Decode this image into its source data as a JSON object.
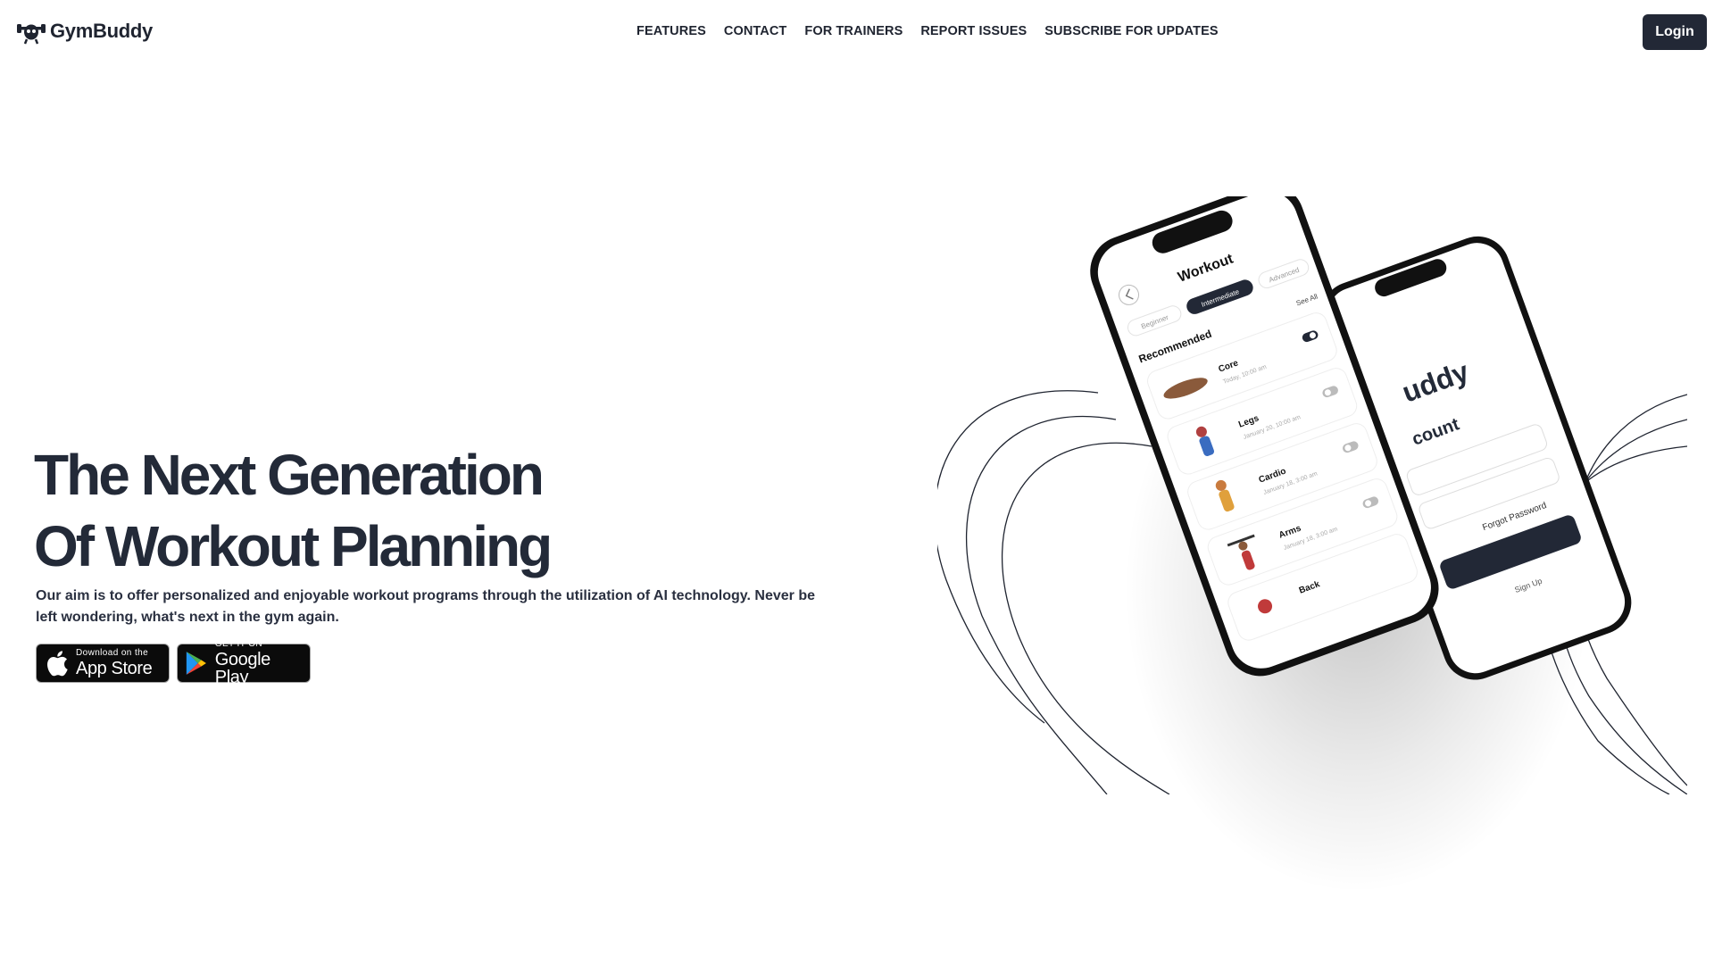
{
  "brand": {
    "name": "GymBuddy",
    "logo_icon": "dumbbell-mascot-icon"
  },
  "nav": {
    "items": [
      {
        "label": "FEATURES"
      },
      {
        "label": "CONTACT"
      },
      {
        "label": "FOR TRAINERS"
      },
      {
        "label": "REPORT ISSUES"
      },
      {
        "label": "SUBSCRIBE FOR UPDATES"
      }
    ],
    "login_label": "Login"
  },
  "hero": {
    "title_line1": "The Next Generation",
    "title_line2": "Of Workout Planning",
    "description": "Our aim is to offer personalized and enjoyable workout programs through the utilization of AI technology. Never be left wondering, what's next in the gym again."
  },
  "badges": {
    "app_store": {
      "small": "Download on the",
      "big": "App Store",
      "icon": "apple-icon"
    },
    "google_play": {
      "small": "GET IT ON",
      "big": "Google Play",
      "icon": "google-play-icon"
    }
  },
  "phone_front": {
    "title": "Workout",
    "back_icon": "chevron-left-icon",
    "tabs": [
      "Beginner",
      "Intermediate",
      "Advanced"
    ],
    "active_tab": "Intermediate",
    "section_title": "Recommended",
    "see_all": "See All",
    "workouts": [
      {
        "name": "Core",
        "date": "Today, 10:00 am",
        "enabled": true
      },
      {
        "name": "Legs",
        "date": "January 20, 10:00 am",
        "enabled": false
      },
      {
        "name": "Cardio",
        "date": "January 18, 3:00 am",
        "enabled": false
      },
      {
        "name": "Arms",
        "date": "January 18, 3:00 am",
        "enabled": false
      },
      {
        "name": "Back",
        "date": "",
        "enabled": false
      }
    ]
  },
  "phone_back": {
    "brand_fragment": "uddy",
    "heading_fragment": "count",
    "forgot_password": "Forgot Password",
    "sign_up": "Sign Up"
  },
  "colors": {
    "dark": "#222836",
    "text": "#232a38",
    "white": "#ffffff"
  }
}
